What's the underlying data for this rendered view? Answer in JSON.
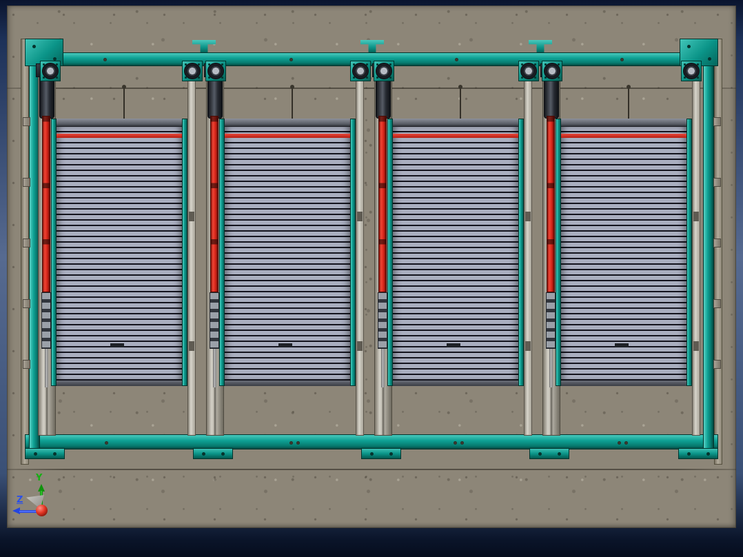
{
  "colors": {
    "concrete": "#8d8678",
    "teal": "#0fa295",
    "teal-light": "#49c9bc",
    "teal-dark": "#05665c",
    "red": "#d6251a",
    "slat": "#a9aebf",
    "slat-line": "#14141e",
    "column": "#b5b1a6",
    "mech-dark": "#31353c",
    "axis-y": "#15b012",
    "axis-z": "#2b50e8",
    "origin-red": "#e23423"
  },
  "machine": {
    "bays": 4,
    "shutter_panels": 4,
    "red_actuators": 4,
    "bearing_units": 8,
    "slats_per_panel_approx": 46
  },
  "triad": {
    "y_label": "Y",
    "z_label": "Z"
  }
}
